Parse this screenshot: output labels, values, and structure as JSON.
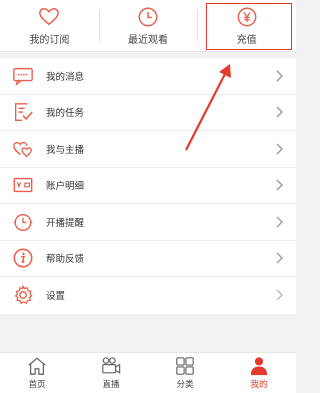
{
  "top": {
    "items": [
      {
        "label": "我的订阅",
        "icon": "heart-icon"
      },
      {
        "label": "最近观看",
        "icon": "clock-icon"
      },
      {
        "label": "充值",
        "icon": "yen-icon"
      }
    ]
  },
  "menu": {
    "items": [
      {
        "label": "我的消息",
        "icon": "message-icon"
      },
      {
        "label": "我的任务",
        "icon": "task-icon"
      },
      {
        "label": "我与主播",
        "icon": "hearts-icon"
      },
      {
        "label": "账户明细",
        "icon": "wallet-icon"
      },
      {
        "label": "开播提醒",
        "icon": "alarm-icon"
      },
      {
        "label": "帮助反馈",
        "icon": "info-icon"
      },
      {
        "label": "设置",
        "icon": "settings-icon"
      }
    ]
  },
  "bottom_nav": {
    "items": [
      {
        "label": "首页",
        "icon": "home-icon"
      },
      {
        "label": "直播",
        "icon": "camera-icon"
      },
      {
        "label": "分类",
        "icon": "grid-icon"
      },
      {
        "label": "我的",
        "icon": "person-icon",
        "active": true
      }
    ]
  },
  "colors": {
    "accent": "#e23a2e",
    "icon": "#e8604c",
    "annotation": "#e23a2e"
  }
}
